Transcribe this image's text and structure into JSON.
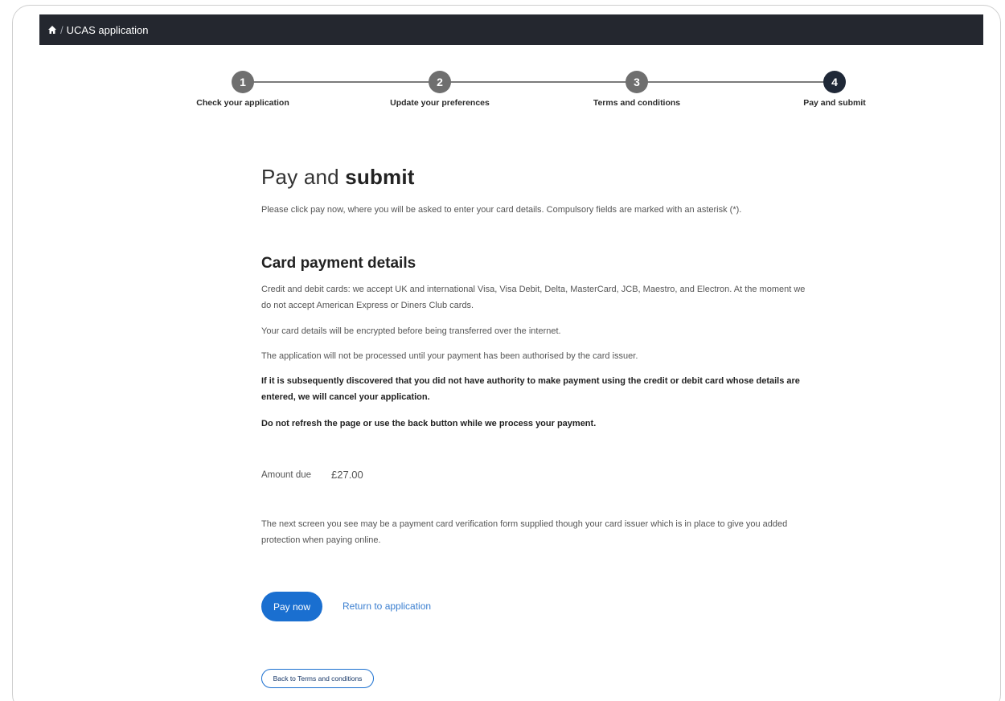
{
  "header": {
    "separator": "/",
    "crumb": "UCAS application"
  },
  "stepper": {
    "steps": [
      {
        "number": "1",
        "label": "Check your application"
      },
      {
        "number": "2",
        "label": "Update your preferences"
      },
      {
        "number": "3",
        "label": "Terms and conditions"
      },
      {
        "number": "4",
        "label": "Pay and submit"
      }
    ],
    "active_step": "4"
  },
  "main": {
    "title_light": "Pay and ",
    "title_bold": "submit",
    "intro": "Please click pay now, where you will be asked to enter your card details. Compulsory fields are marked with an asterisk (*).",
    "section_title": "Card payment details",
    "paragraphs": [
      "Credit and debit cards: we accept UK and international Visa, Visa Debit, Delta, MasterCard, JCB, Maestro, and Electron. At the moment we do not accept American Express or Diners Club cards.",
      "Your card details will be encrypted before being transferred over the internet.",
      "The application will not be processed until your payment has been authorised by the card issuer.",
      "If it is subsequently discovered that you did not have authority to make payment using the credit or debit card whose details are entered, we will cancel your application.",
      "Do not refresh the page or use the back button while we process your payment."
    ],
    "amount_label": "Amount due",
    "amount_value": "£27.00",
    "verification_note": "The next screen you see may be a payment card verification form supplied though your card issuer which is in place to give you added protection when paying online.",
    "pay_button": "Pay now",
    "return_link": "Return to application",
    "back_button": "Back to Terms and conditions"
  },
  "colors": {
    "header_bg": "#24272f",
    "accent": "#1a6fd0",
    "step_inactive": "#6f6f6f",
    "step_active": "#1f2837"
  }
}
